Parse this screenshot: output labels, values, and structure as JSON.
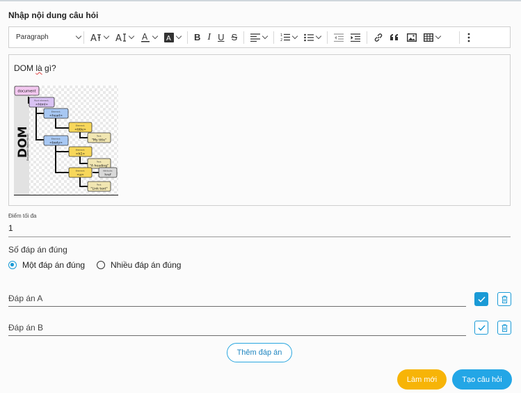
{
  "form": {
    "title": "Nhập nội dung câu hỏi",
    "question_text": "DOM là gì?",
    "question_word_1": "DOM ",
    "question_word_spell": "là",
    "question_word_3": " gì?"
  },
  "toolbar": {
    "paragraph_label": "Paragraph",
    "icons": [
      "font-size-icon",
      "font-family-icon",
      "font-color-icon",
      "font-background-color-icon",
      "bold-icon",
      "italic-icon",
      "underline-icon",
      "strikethrough-icon",
      "align-icon",
      "numbered-list-icon",
      "bulleted-list-icon",
      "outdent-icon",
      "indent-icon",
      "link-icon",
      "blockquote-icon",
      "image-icon",
      "table-icon",
      "more-options-icon"
    ],
    "bold": "B",
    "italic": "I",
    "underline": "U",
    "strike": "S"
  },
  "diagram": {
    "big_label": "DOM",
    "side_label": "Document Object Model",
    "nodes": {
      "document": "document",
      "html_cap": "Root element:",
      "html": "<html>",
      "head_cap": "Element:",
      "head": "<head>",
      "title_cap": "Element:",
      "title": "<title>",
      "mytitle_cap": "Text:",
      "mytitle": "\"My title\"",
      "body_cap": "Element:",
      "body": "<body>",
      "h1_cap": "Element:",
      "h1": "<h1>",
      "heading_cap": "Text:",
      "heading": "\"A heading\"",
      "a_cap": "Element:",
      "a": "<a>",
      "href_cap": "Attribute:",
      "href": "href",
      "link_cap": "Text:",
      "link": "\"Link text\""
    }
  },
  "score": {
    "label": "Điểm tối đa",
    "value": "1"
  },
  "correct": {
    "label": "Số đáp án đúng",
    "options": [
      "Một đáp án đúng",
      "Nhiều đáp án đúng"
    ],
    "selected": "Một đáp án đúng"
  },
  "answers": [
    {
      "placeholder": "Đáp án A",
      "value": "",
      "correct": true
    },
    {
      "placeholder": "Đáp án B",
      "value": "",
      "correct": false
    }
  ],
  "buttons": {
    "add_answer": "Thêm đáp án",
    "reset": "Làm mới",
    "create": "Tạo câu hỏi"
  },
  "colors": {
    "accent": "#23a6e6",
    "reset": "#f7b407"
  }
}
